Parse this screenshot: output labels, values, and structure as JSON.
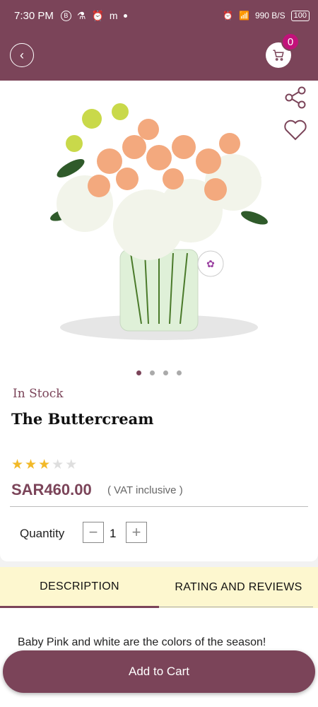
{
  "status_bar": {
    "time": "7:30 PM",
    "left_icons": [
      "B",
      "flask-icon",
      "alarm-icon",
      "m",
      "dot"
    ],
    "net_speed": "990 B/S",
    "battery": "100"
  },
  "header": {
    "back_icon": "chevron-left-icon",
    "cart_icon": "cart-icon",
    "cart_count": "0"
  },
  "product": {
    "image_alt": "flower-bouquet",
    "share_icon": "share-icon",
    "wishlist_icon": "heart-icon",
    "carousel": {
      "count": 4,
      "active": 0
    },
    "stock_status": "In Stock",
    "name": "The Buttercream",
    "rating": {
      "value": 3,
      "max": 5
    },
    "price": "SAR460.00",
    "vat_note": "( VAT inclusive )",
    "quantity_label": "Quantity",
    "quantity": "1"
  },
  "tabs": [
    {
      "label": "DESCRIPTION",
      "active": true
    },
    {
      "label": "RATING AND REVIEWS",
      "active": false
    }
  ],
  "description": {
    "text": "Baby Pink and white are the colors of the season!"
  },
  "actions": {
    "add_to_cart": "Add to Cart"
  },
  "colors": {
    "brand": "#7b4459",
    "badge": "#c2127a",
    "star": "#f2b928",
    "tab_bg": "#fdf7cf"
  }
}
